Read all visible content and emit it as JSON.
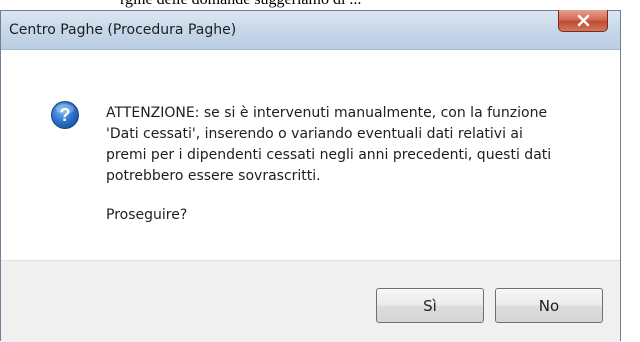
{
  "page_top_text": "rgine delle domande suggeriamo di ...",
  "window": {
    "title": "Centro Paghe (Procedura Paghe)",
    "close_label": "X"
  },
  "dialog": {
    "icon": "question-icon",
    "message_lines": [
      "ATTENZIONE: se si è intervenuti manualmente, con la funzione",
      "'Dati cessati', inserendo o variando eventuali dati relativi ai",
      "premi per i dipendenti cessati negli anni precedenti, questi dati",
      "potrebbero essere sovrascritti."
    ],
    "prompt": "Proseguire?"
  },
  "buttons": {
    "yes": "Sì",
    "no": "No"
  },
  "colors": {
    "titlebar": "#c9d9ea",
    "close_button": "#d46c55",
    "icon_blue": "#2a6fc9",
    "footer": "#f0f0f0"
  }
}
